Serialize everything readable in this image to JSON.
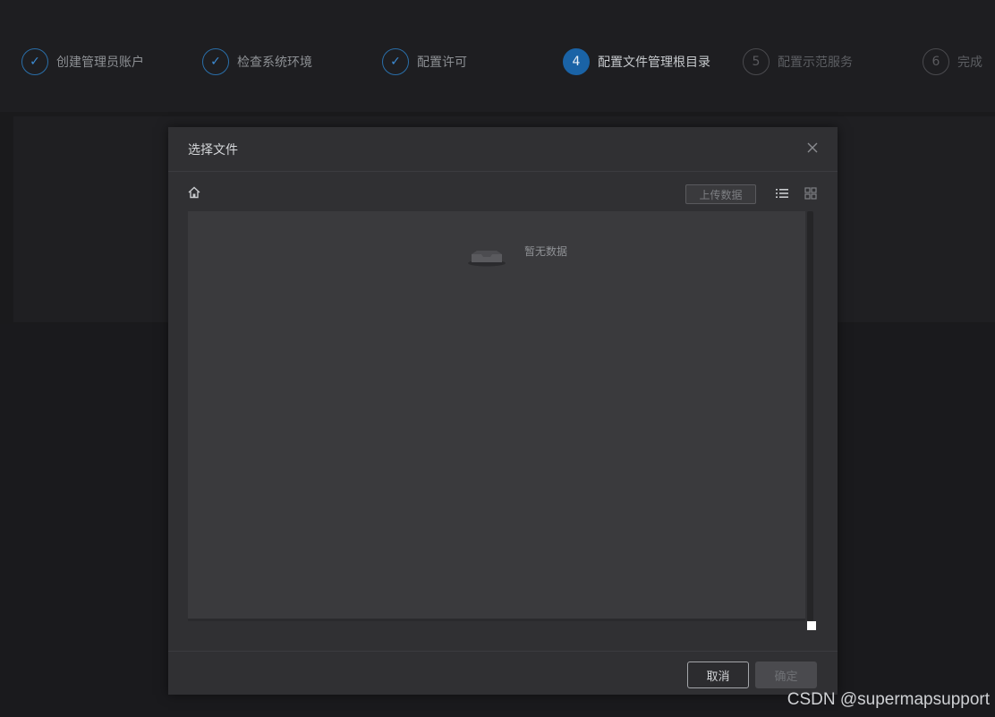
{
  "steps": [
    {
      "label": "创建管理员账户",
      "state": "done",
      "symbol": "✓"
    },
    {
      "label": "检查系统环境",
      "state": "done",
      "symbol": "✓"
    },
    {
      "label": "配置许可",
      "state": "done",
      "symbol": "✓"
    },
    {
      "label": "配置文件管理根目录",
      "state": "active",
      "symbol": "4"
    },
    {
      "label": "配置示范服务",
      "state": "pending",
      "symbol": "5"
    },
    {
      "label": "完成",
      "state": "pending",
      "symbol": "6"
    }
  ],
  "dialog": {
    "title": "选择文件",
    "close_icon": "close-icon",
    "toolbar": {
      "home_icon": "home-icon",
      "upload_label": "上传数据",
      "list_icon": "list-view-icon",
      "grid_icon": "grid-view-icon"
    },
    "empty_text": "暂无数据",
    "cancel_label": "取消",
    "ok_label": "确定"
  },
  "watermark": "CSDN @supermapsupport",
  "colors": {
    "accent": "#1a63a6",
    "dialog_bg": "#303033",
    "page_bg": "#1a1a1c"
  }
}
